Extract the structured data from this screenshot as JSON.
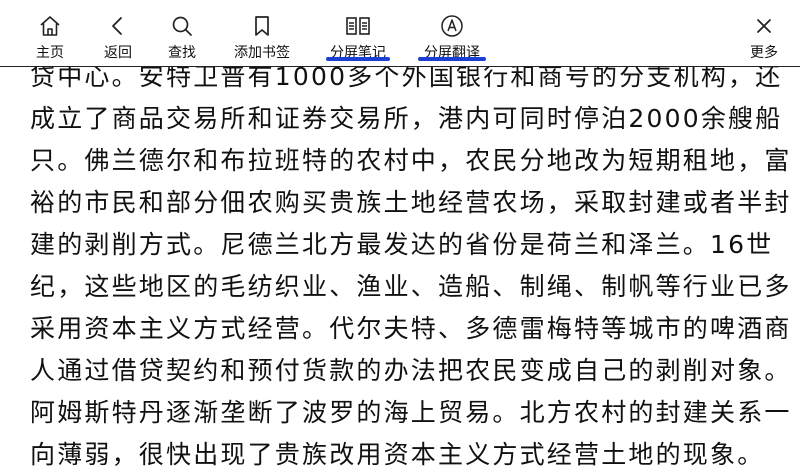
{
  "toolbar": {
    "items": [
      {
        "label": "主页",
        "icon": "home-icon"
      },
      {
        "label": "返回",
        "icon": "back-icon"
      },
      {
        "label": "查找",
        "icon": "search-icon"
      },
      {
        "label": "添加书签",
        "icon": "bookmark-icon"
      },
      {
        "label": "分屏笔记",
        "icon": "split-notes-icon"
      },
      {
        "label": "分屏翻译",
        "icon": "translate-icon"
      },
      {
        "label": "更多",
        "icon": "more-icon"
      }
    ],
    "highlight_color": "#1a3fd6"
  },
  "content": {
    "lines": [
      "贷中心。安特卫普有1000多个外国银行和商号的分支机构，还",
      "成立了商品交易所和证券交易所，港内可同时停泊2000余艘船",
      "只。佛兰德尔和布拉班特的农村中，农民分地改为短期租地，富",
      "裕的市民和部分佃农购买贵族土地经营农场，采取封建或者半封",
      "建的剥削方式。尼德兰北方最发达的省份是荷兰和泽兰。16世",
      "纪，这些地区的毛纺织业、渔业、造船、制绳、制帆等行业已多",
      "采用资本主义方式经营。代尔夫特、多德雷梅特等城市的啤酒商",
      "人通过借贷契约和预付货款的办法把农民变成自己的剥削对象。",
      "阿姆斯特丹逐渐垄断了波罗的海上贸易。北方农村的封建关系一",
      "向薄弱，很快出现了贵族改用资本主义方式经营土地的现象。"
    ]
  }
}
